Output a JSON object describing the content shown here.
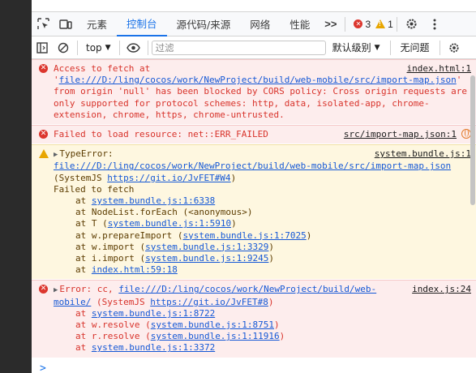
{
  "tabs": [
    {
      "label": "元素"
    },
    {
      "label": "控制台"
    },
    {
      "label": "源代码/来源"
    },
    {
      "label": "网络"
    },
    {
      "label": "性能"
    }
  ],
  "tabbar": {
    "more": ">>",
    "error_count": "3",
    "warning_count": "1"
  },
  "toolbar": {
    "context": "top",
    "filter_placeholder": "过滤",
    "levels": "默认级别",
    "issues": "无问题"
  },
  "messages": {
    "m1": {
      "src": "index.html:1",
      "text": "Access to fetch at '",
      "url": "file:///D:/ling/cocos/work/NewProject/build/web-mobile/src/import-map.json",
      "rest": "' from origin 'null' has been blocked by CORS policy: Cross origin requests are only supported for protocol schemes: http, data, isolated-app, chrome-extension, chrome, https, chrome-untrusted."
    },
    "m2": {
      "text": "Failed to load resource: net::ERR_FAILED",
      "src": "src/import-map.json:1"
    },
    "m3": {
      "prefix": "TypeError: ",
      "url": "file:///D:/ling/cocos/work/NewProject/build/web-mobile/src/import-map.json",
      "src": "system.bundle.js:1",
      "mid": " (SystemJS ",
      "link": "https://git.io/JvFET#W4",
      "end": ")",
      "line2": "Failed to fetch",
      "frames": [
        {
          "pre": "at ",
          "fn": "",
          "link": "system.bundle.js:1:6338",
          "post": ""
        },
        {
          "pre": "at NodeList.forEach (<anonymous>)",
          "fn": "",
          "link": "",
          "post": ""
        },
        {
          "pre": "at T (",
          "fn": "",
          "link": "system.bundle.js:1:5910",
          "post": ")"
        },
        {
          "pre": "at w.prepareImport (",
          "fn": "",
          "link": "system.bundle.js:1:7025",
          "post": ")"
        },
        {
          "pre": "at w.import (",
          "fn": "",
          "link": "system.bundle.js:1:3329",
          "post": ")"
        },
        {
          "pre": "at i.import (",
          "fn": "",
          "link": "system.bundle.js:1:9245",
          "post": ")"
        },
        {
          "pre": "at ",
          "fn": "",
          "link": "index.html:59:18",
          "post": ""
        }
      ]
    },
    "m4": {
      "prefix": "Error: cc, ",
      "url": "file:///D:/ling/cocos/work/NewProject/build/web-mobile/",
      "src": "index.js:24",
      "mid": " (SystemJS ",
      "link": "https://git.io/JvFET#8",
      "end": ")",
      "frames": [
        {
          "pre": "at ",
          "link": "system.bundle.js:1:8722",
          "post": ""
        },
        {
          "pre": "at w.resolve (",
          "link": "system.bundle.js:1:8751",
          "post": ")"
        },
        {
          "pre": "at r.resolve (",
          "link": "system.bundle.js:1:11916",
          "post": ")"
        },
        {
          "pre": "at ",
          "link": "system.bundle.js:1:3372",
          "post": ""
        }
      ]
    }
  },
  "prompt": ">"
}
